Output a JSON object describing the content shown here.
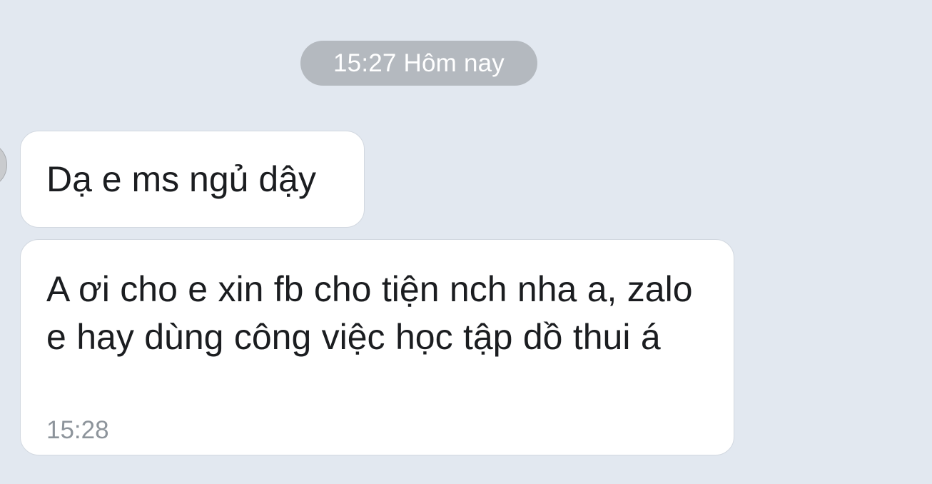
{
  "divider": {
    "text": "15:27 Hôm nay"
  },
  "messages": [
    {
      "text": "Dạ e ms ngủ dậy"
    },
    {
      "text": "A ơi cho e xin fb cho tiện nch nha a, zalo e hay dùng công việc học tập dồ thui á",
      "time": "15:28"
    }
  ],
  "colors": {
    "background": "#e2e8f0",
    "bubble": "#ffffff",
    "divider_bg": "#b4b9bf",
    "text": "#1b1d20",
    "time": "#8d949b"
  }
}
